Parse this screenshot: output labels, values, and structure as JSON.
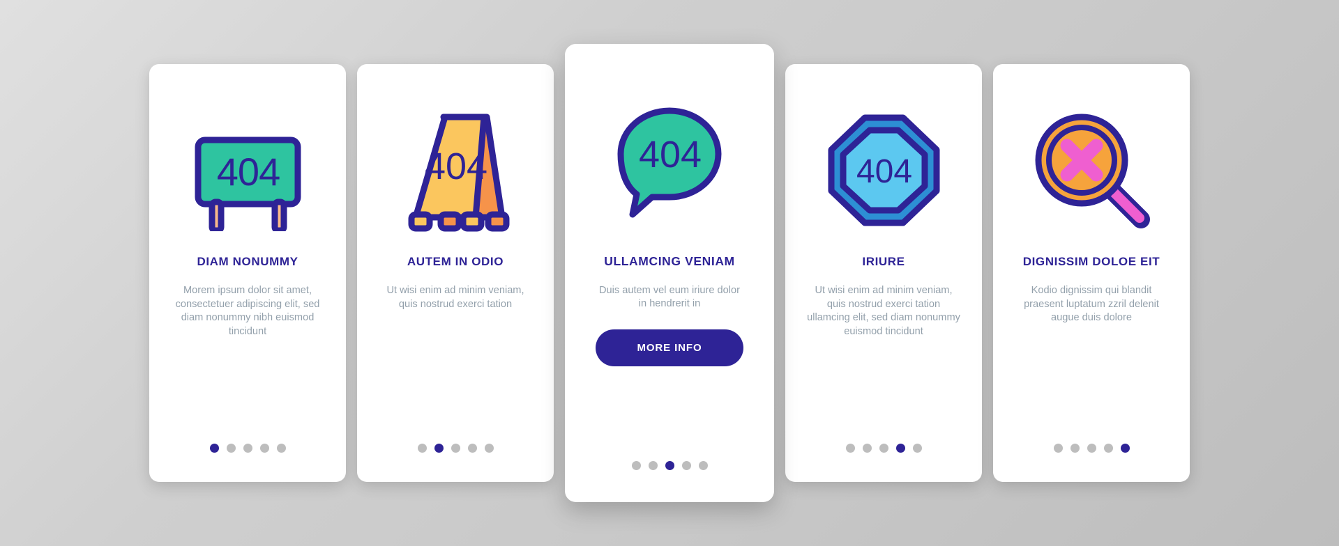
{
  "page": {
    "background_gradient_from": "#e0e0e0",
    "background_gradient_to": "#bdbdbd",
    "accent_color": "#2e2396",
    "body_text_color": "#93a0ab",
    "dot_inactive_color": "#bdbdbd"
  },
  "cards": [
    {
      "icon_name": "billboard-404-icon",
      "icon_code": "404",
      "icon_colors": {
        "fill": "#2ec4a0",
        "stroke": "#2e2396",
        "accent": "#f9b98a"
      },
      "title": "DIAM NONUMMY",
      "body": "Morem ipsum dolor sit amet, consectetuer adipiscing elit, sed diam nonummy nibh euismod tincidunt",
      "dots": {
        "count": 5,
        "active_index": 0
      },
      "featured": false,
      "cta": null
    },
    {
      "icon_name": "a-frame-sign-404-icon",
      "icon_code": "404",
      "icon_colors": {
        "fill": "#fbc65e",
        "stroke": "#2e2396",
        "accent": "#f6934a"
      },
      "title": "AUTEM IN ODIO",
      "body": "Ut wisi enim ad minim veniam, quis nostrud exerci tation",
      "dots": {
        "count": 5,
        "active_index": 1
      },
      "featured": false,
      "cta": null
    },
    {
      "icon_name": "speech-bubble-404-icon",
      "icon_code": "404",
      "icon_colors": {
        "fill": "#2ec4a0",
        "stroke": "#2e2396",
        "accent": "#2ec4a0"
      },
      "title": "ULLAMCING VENIAM",
      "body": "Duis autem vel eum iriure dolor in hendrerit in",
      "dots": {
        "count": 5,
        "active_index": 2
      },
      "featured": true,
      "cta": "MORE INFO"
    },
    {
      "icon_name": "octagon-stop-sign-404-icon",
      "icon_code": "404",
      "icon_colors": {
        "fill": "#5cc8f0",
        "stroke": "#2e2396",
        "accent": "#2d8fd4"
      },
      "title": "IRIURE",
      "body": "Ut wisi enim ad minim veniam, quis nostrud exerci tation ullamcing elit, sed diam nonummy euismod tincidunt",
      "dots": {
        "count": 5,
        "active_index": 3
      },
      "featured": false,
      "cta": null
    },
    {
      "icon_name": "magnifier-error-cross-icon",
      "icon_code": "",
      "icon_colors": {
        "fill": "#f6a33c",
        "stroke": "#2e2396",
        "accent": "#ef5fd0"
      },
      "title": "DIGNISSIM DOLOE EIT",
      "body": "Kodio dignissim qui blandit praesent luptatum zzril delenit augue duis dolore",
      "dots": {
        "count": 5,
        "active_index": 4
      },
      "featured": false,
      "cta": null
    }
  ]
}
